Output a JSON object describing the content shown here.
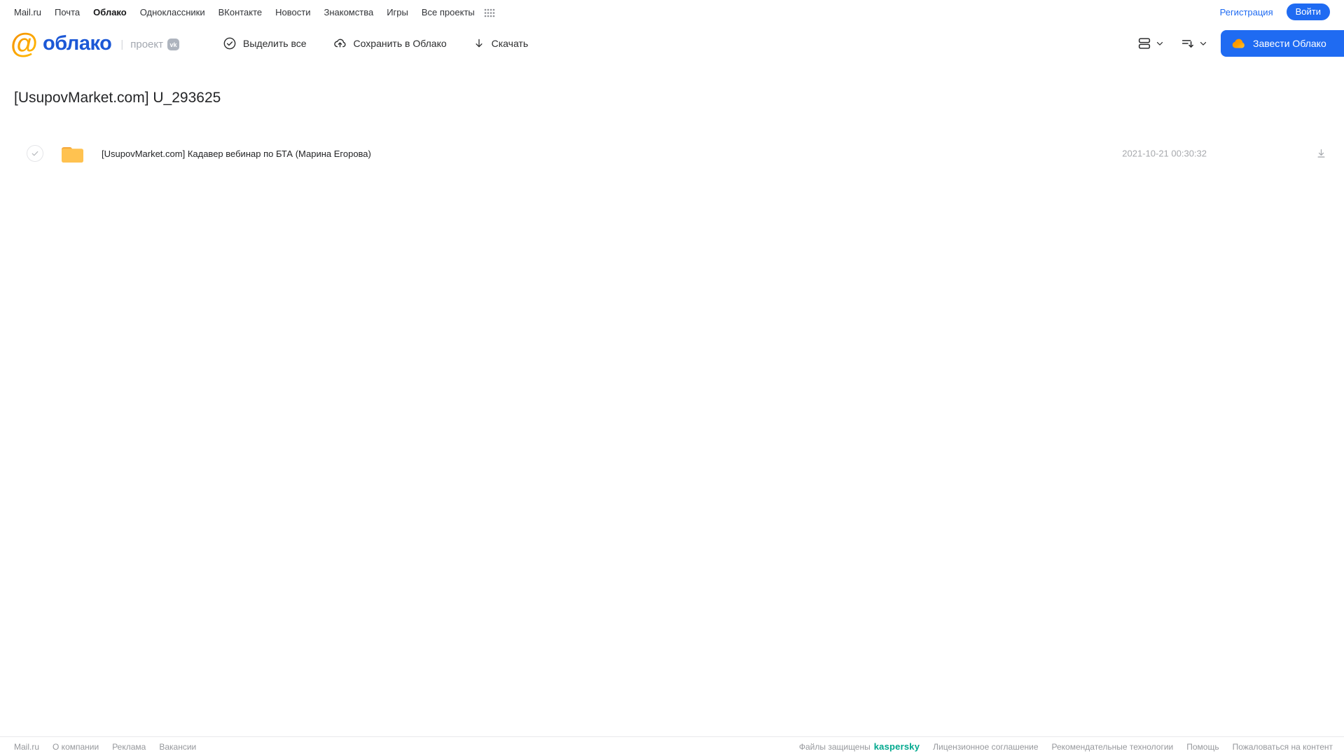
{
  "colors": {
    "accent_blue": "#1f6bf2",
    "logo_blue": "#1c58d6",
    "logo_orange": "#ff9e00",
    "folder_body": "#ffc250",
    "folder_tab": "#f6a93c",
    "kaspersky_green": "#00a88e",
    "text_dark": "#2c2d2e",
    "text_gray": "#96989c"
  },
  "topnav": {
    "items": [
      {
        "label": "Mail.ru",
        "active": false
      },
      {
        "label": "Почта",
        "active": false
      },
      {
        "label": "Облако",
        "active": true
      },
      {
        "label": "Одноклассники",
        "active": false
      },
      {
        "label": "ВКонтакте",
        "active": false
      },
      {
        "label": "Новости",
        "active": false
      },
      {
        "label": "Знакомства",
        "active": false
      },
      {
        "label": "Игры",
        "active": false
      },
      {
        "label": "Все проекты",
        "active": false
      }
    ],
    "apps_grid_icon": "apps-grid-icon",
    "registration_label": "Регистрация",
    "login_label": "Войти"
  },
  "header": {
    "logo_at": "@",
    "logo_text": "облако",
    "project_divider": "|",
    "project_label": "проект",
    "vk_badge_label": "vk",
    "toolbar": [
      {
        "label": "Выделить все",
        "icon": "check-circle-icon"
      },
      {
        "label": "Сохранить в Облако",
        "icon": "cloud-upload-icon"
      },
      {
        "label": "Скачать",
        "icon": "download-icon"
      }
    ],
    "view_mode_icon": "view-rows-icon",
    "sort_icon": "sort-icon",
    "create_cloud_label": "Завести Облако",
    "create_cloud_icon": "cloud-icon"
  },
  "main": {
    "title": "[UsupovMarket.com] U_293625",
    "files": [
      {
        "type": "folder",
        "icon": "folder-icon",
        "checked": false,
        "name": "[UsupovMarket.com] Кадавер вебинар по БТА (Марина Егорова)",
        "date": "2021-10-21 00:30:32",
        "download_icon": "download-tray-icon"
      }
    ]
  },
  "footer": {
    "left_links": [
      "Mail.ru",
      "О компании",
      "Реклама",
      "Вакансии"
    ],
    "protected_text": "Файлы защищены",
    "kaspersky_label": "kaspersky",
    "right_links": [
      "Лицензионное соглашение",
      "Рекомендательные технологии",
      "Помощь",
      "Пожаловаться на контент"
    ]
  }
}
